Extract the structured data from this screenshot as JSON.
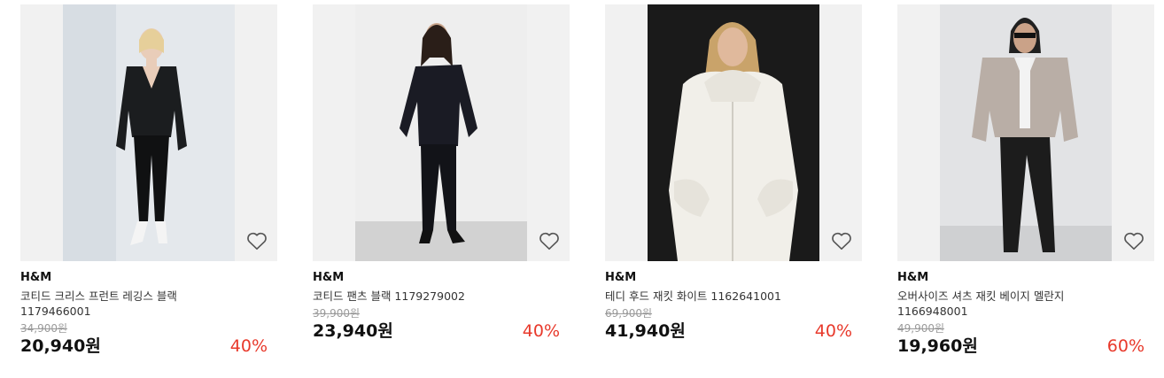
{
  "products": [
    {
      "brand": "H&M",
      "name": "코티드 크리스 프런트 레깅스 블랙 1179466001",
      "original_price": "34,900원",
      "sale_price": "20,940원",
      "discount": "40%"
    },
    {
      "brand": "H&M",
      "name": "코티드 팬츠 블랙 1179279002",
      "original_price": "39,900원",
      "sale_price": "23,940원",
      "discount": "40%"
    },
    {
      "brand": "H&M",
      "name": "테디 후드 재킷 화이트 1162641001",
      "original_price": "69,900원",
      "sale_price": "41,940원",
      "discount": "40%"
    },
    {
      "brand": "H&M",
      "name": "오버사이즈 셔츠 재킷 베이지 멜란지 1166948001",
      "original_price": "49,900원",
      "sale_price": "19,960원",
      "discount": "60%"
    }
  ],
  "colors": {
    "discount": "#e8392b",
    "price": "#111111",
    "original_price": "#9a9a9a",
    "thumb_bg": "#f1f1f1"
  },
  "icons": {
    "wishlist": "heart-outline-icon"
  }
}
